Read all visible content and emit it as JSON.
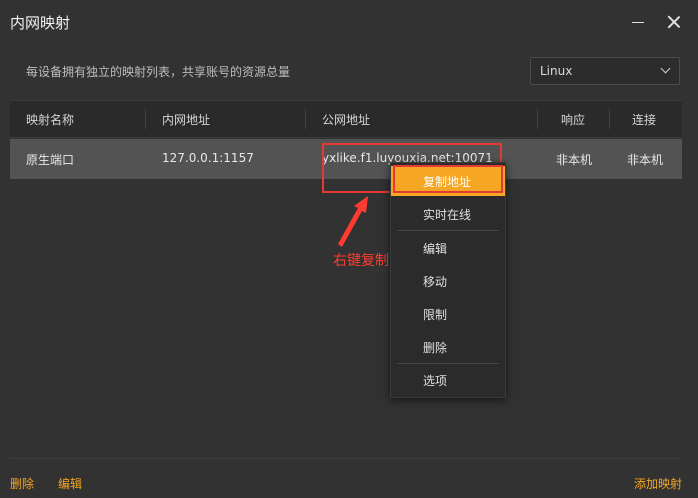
{
  "window": {
    "title": "内网映射",
    "minimize_icon": "minimize-icon",
    "close_icon": "close-icon"
  },
  "header": {
    "description": "每设备拥有独立的映射列表，共享账号的资源总量",
    "os_select": {
      "value": "Linux",
      "icon": "chevron-down-icon"
    }
  },
  "table": {
    "columns": [
      "映射名称",
      "内网地址",
      "公网地址",
      "响应",
      "连接"
    ],
    "rows": [
      {
        "name": "原生端口",
        "internal": "127.0.0.1:1157",
        "public": "yxlike.f1.luyouxia.net:10071",
        "response": "非本机",
        "connection": "非本机"
      }
    ]
  },
  "context_menu": {
    "items": [
      "复制地址",
      "实时在线",
      "编辑",
      "移动",
      "限制",
      "删除",
      "选项"
    ],
    "active_index": 0
  },
  "annotation": {
    "label": "右键复制",
    "color": "#ff3b30"
  },
  "footer": {
    "delete_label": "删除",
    "edit_label": "编辑",
    "add_label": "添加映射"
  },
  "colors": {
    "accent": "#f5a623",
    "background": "#323232",
    "selected_row": "#535353"
  }
}
